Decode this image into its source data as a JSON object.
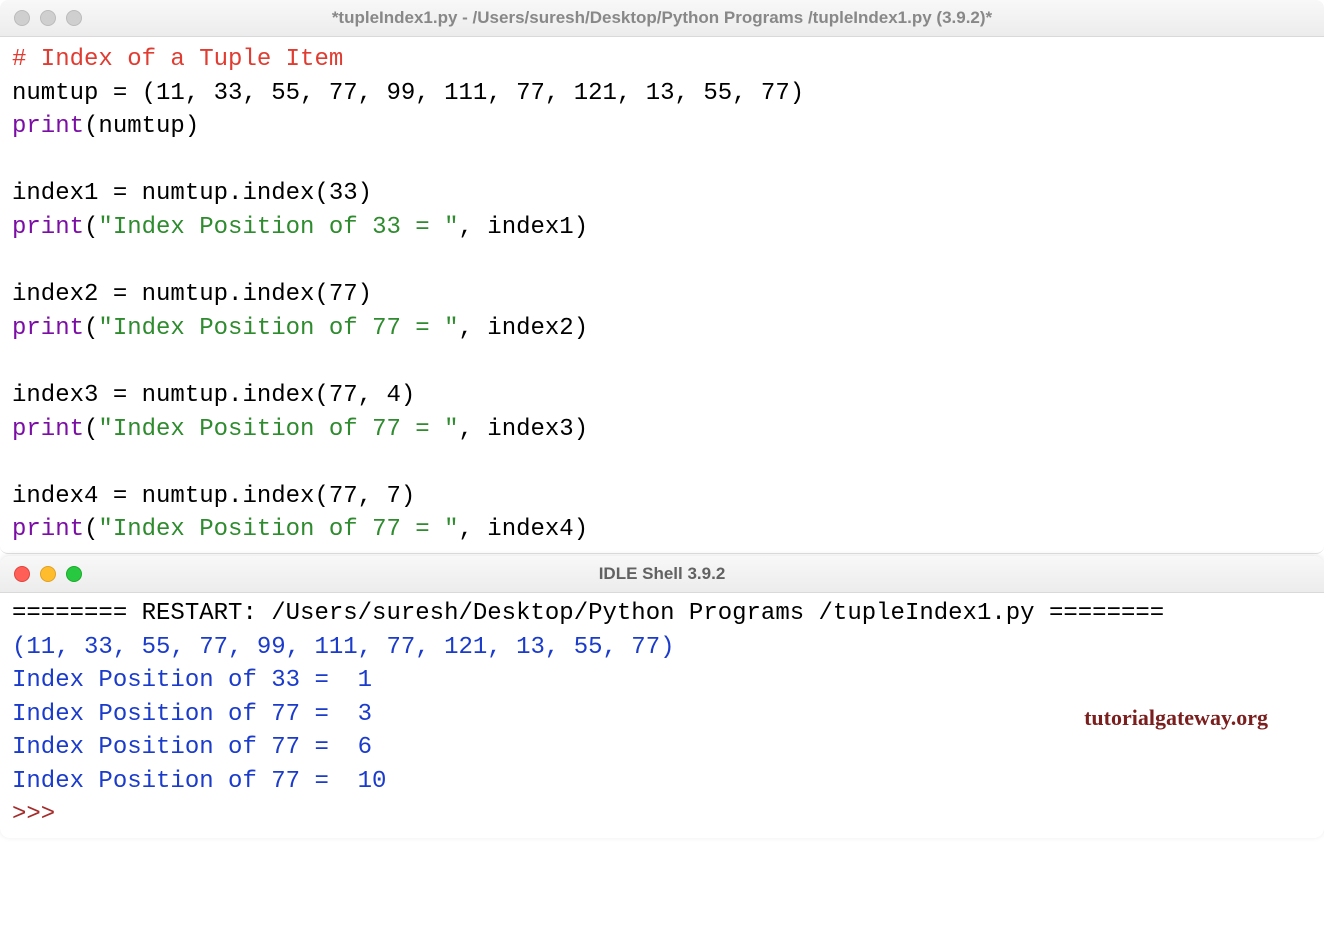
{
  "editor": {
    "title": "*tupleIndex1.py - /Users/suresh/Desktop/Python Programs /tupleIndex1.py (3.9.2)*",
    "code": {
      "l1_comment": "# Index of a Tuple Item",
      "l2": "numtup = (11, 33, 55, 77, 99, 111, 77, 121, 13, 55, 77)",
      "l3_func": "print",
      "l3_rest": "(numtup)",
      "l5": "index1 = numtup.index(33)",
      "l6_func": "print",
      "l6_open": "(",
      "l6_str": "\"Index Position of 33 = \"",
      "l6_rest": ", index1)",
      "l8": "index2 = numtup.index(77)",
      "l9_func": "print",
      "l9_open": "(",
      "l9_str": "\"Index Position of 77 = \"",
      "l9_rest": ", index2)",
      "l11": "index3 = numtup.index(77, 4)",
      "l12_func": "print",
      "l12_open": "(",
      "l12_str": "\"Index Position of 77 = \"",
      "l12_rest": ", index3)",
      "l14": "index4 = numtup.index(77, 7)",
      "l15_func": "print",
      "l15_open": "(",
      "l15_str": "\"Index Position of 77 = \"",
      "l15_rest": ", index4)"
    }
  },
  "shell": {
    "title": "IDLE Shell 3.9.2",
    "restart": "======== RESTART: /Users/suresh/Desktop/Python Programs /tupleIndex1.py ========",
    "out1": "(11, 33, 55, 77, 99, 111, 77, 121, 13, 55, 77)",
    "out2": "Index Position of 33 =  1",
    "out3": "Index Position of 77 =  3",
    "out4": "Index Position of 77 =  6",
    "out5": "Index Position of 77 =  10",
    "prompt": ">>> "
  },
  "watermark": "tutorialgateway.org"
}
